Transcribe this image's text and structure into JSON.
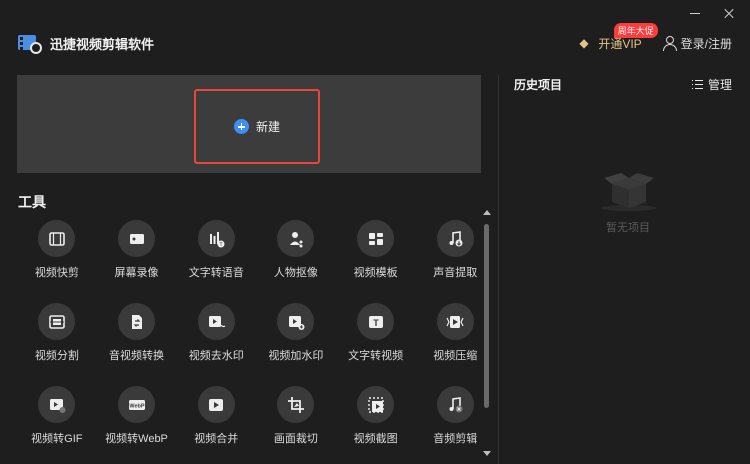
{
  "app": {
    "title": "迅捷视频剪辑软件"
  },
  "header": {
    "vip_label": "开通VIP",
    "vip_badge": "周年大促",
    "login_label": "登录/注册"
  },
  "new_project": {
    "label": "新建"
  },
  "tools": {
    "title": "工具",
    "items": [
      {
        "label": "视频快剪",
        "icon": "film-icon"
      },
      {
        "label": "屏幕录像",
        "icon": "screen-record-icon"
      },
      {
        "label": "文字转语音",
        "icon": "text-to-speech-icon"
      },
      {
        "label": "人物抠像",
        "icon": "person-cutout-icon"
      },
      {
        "label": "视频模板",
        "icon": "template-icon"
      },
      {
        "label": "声音提取",
        "icon": "audio-extract-icon"
      },
      {
        "label": "视频分割",
        "icon": "split-icon"
      },
      {
        "label": "音视频转换",
        "icon": "convert-icon"
      },
      {
        "label": "视频去水印",
        "icon": "remove-watermark-icon"
      },
      {
        "label": "视频加水印",
        "icon": "add-watermark-icon"
      },
      {
        "label": "文字转视频",
        "icon": "text-to-video-icon"
      },
      {
        "label": "视频压缩",
        "icon": "compress-icon"
      },
      {
        "label": "视频转GIF",
        "icon": "gif-icon"
      },
      {
        "label": "视频转WebP",
        "icon": "webp-icon"
      },
      {
        "label": "视频合并",
        "icon": "merge-icon"
      },
      {
        "label": "画面裁切",
        "icon": "crop-icon"
      },
      {
        "label": "视频截图",
        "icon": "screenshot-icon"
      },
      {
        "label": "音频剪辑",
        "icon": "audio-edit-icon"
      }
    ]
  },
  "history": {
    "title": "历史项目",
    "manage_label": "管理",
    "empty_text": "暂无项目"
  },
  "colors": {
    "accent_blue": "#3d8ff5",
    "highlight_red": "#e8473a",
    "vip_gold": "#e6c385",
    "badge_red": "#ff3b3b"
  }
}
